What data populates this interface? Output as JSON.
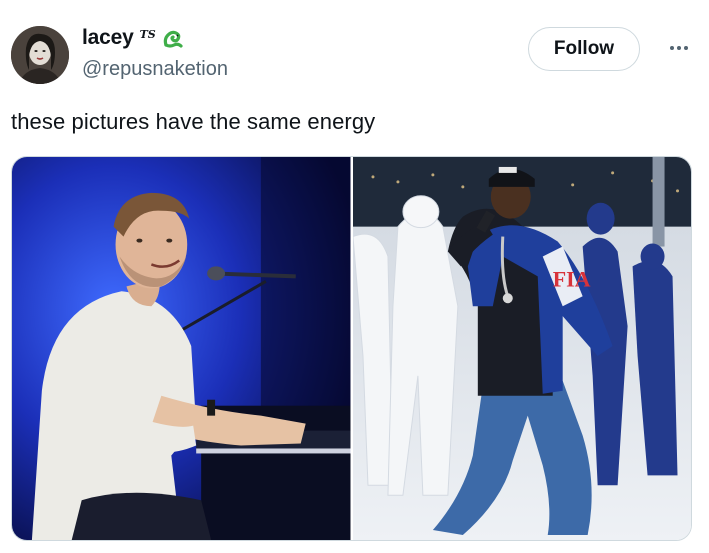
{
  "author": {
    "display_name": "lacey",
    "badge_text": "TS",
    "handle": "@repusnaketion"
  },
  "actions": {
    "follow_label": "Follow",
    "more_icon": "more-horizontal-icon"
  },
  "tweet": {
    "text": "these pictures have the same energy"
  },
  "media": {
    "count": 2
  },
  "colors": {
    "text_primary": "#0f1419",
    "text_secondary": "#536471",
    "border": "#cfd9de",
    "snake_green": "#3fae49"
  }
}
